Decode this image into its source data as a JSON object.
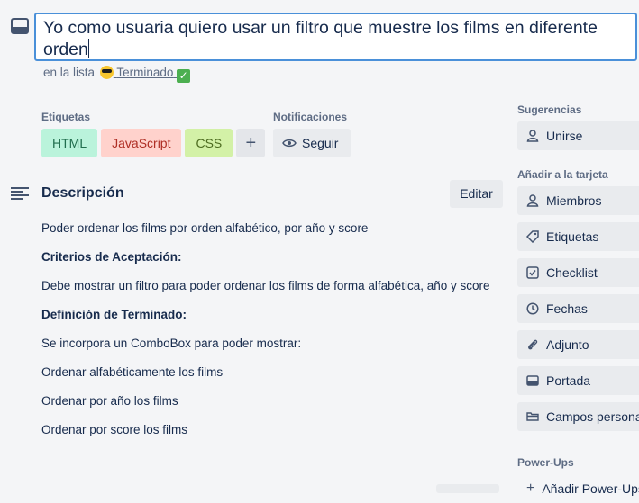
{
  "card": {
    "title": "Yo como usuaria quiero usar un filtro que muestre los films en diferente orden",
    "in_list_prefix": "en la lista",
    "list_name": "Terminado"
  },
  "labels_section": {
    "heading": "Etiquetas",
    "tags": [
      {
        "name": "HTML",
        "color": "#baf3db"
      },
      {
        "name": "JavaScript",
        "color": "#ffd2cc"
      },
      {
        "name": "CSS",
        "color": "#d3f1a7"
      }
    ],
    "add_label": "+"
  },
  "notifications": {
    "heading": "Notificaciones",
    "follow_label": "Seguir"
  },
  "description": {
    "heading": "Descripción",
    "edit_label": "Editar",
    "paragraphs": [
      "Poder ordenar los films por orden alfabético, por año y score",
      "Criterios de Aceptación:",
      "Debe mostrar un filtro para poder ordenar los films de forma alfabética, año y score",
      "Definición de Terminado:",
      "Se incorpora un ComboBox para poder mostrar:",
      "Ordenar alfabéticamente los films",
      "Ordenar por año los films",
      "Ordenar por score los films"
    ]
  },
  "sidebar": {
    "suggestions_heading": "Sugerencias",
    "join_label": "Unirse",
    "add_to_card_heading": "Añadir a la tarjeta",
    "items": [
      {
        "label": "Miembros",
        "icon": "person-icon"
      },
      {
        "label": "Etiquetas",
        "icon": "tag-icon"
      },
      {
        "label": "Checklist",
        "icon": "checklist-icon"
      },
      {
        "label": "Fechas",
        "icon": "clock-icon"
      },
      {
        "label": "Adjunto",
        "icon": "paperclip-icon"
      },
      {
        "label": "Portada",
        "icon": "cover-icon"
      },
      {
        "label": "Campos personalizados",
        "icon": "custom-fields-icon"
      }
    ],
    "powerups_heading": "Power-Ups",
    "add_powerups_label": "Añadir Power-Ups"
  }
}
